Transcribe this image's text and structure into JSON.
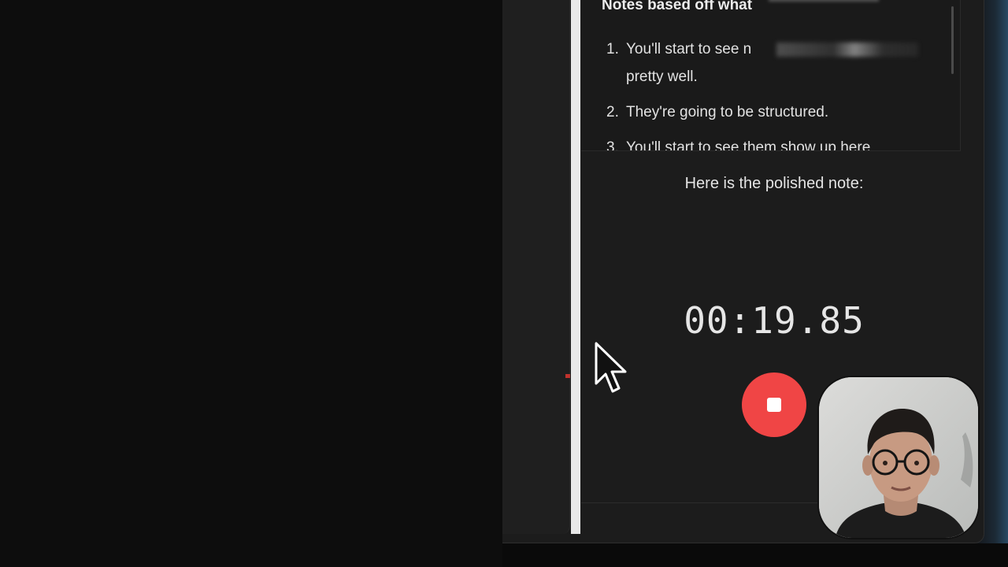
{
  "notes": {
    "heading": "Notes based off what",
    "items": [
      {
        "number": "1.",
        "lines": [
          "You'll start to see n",
          "pretty well."
        ]
      },
      {
        "number": "2.",
        "lines": [
          "They're going to be structured."
        ]
      },
      {
        "number": "3.",
        "lines": [
          "You'll start to see them show up here"
        ]
      }
    ]
  },
  "recorder": {
    "status_text": "Here is the polished note:",
    "timer": "00:19.85",
    "stop_button_icon": "stop-icon",
    "stop_button_color": "#f04545"
  },
  "icons": {
    "cursor": "mouse-pointer-icon"
  },
  "colors": {
    "background": "#1c1c1c",
    "text": "#e4e4e4",
    "accent": "#f04545"
  }
}
